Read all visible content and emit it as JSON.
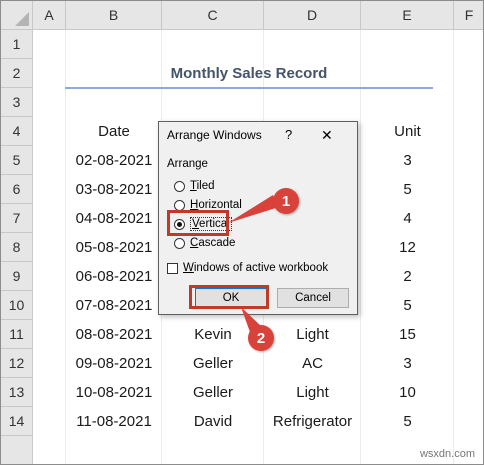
{
  "columns": [
    "A",
    "B",
    "C",
    "D",
    "E",
    "F"
  ],
  "rows": [
    "1",
    "2",
    "3",
    "4",
    "5",
    "6",
    "7",
    "8",
    "9",
    "10",
    "11",
    "12",
    "13",
    "14"
  ],
  "sheet": {
    "title": "Monthly Sales Record",
    "headers": {
      "date": "Date",
      "unit": "Unit"
    },
    "dates": [
      "02-08-2021",
      "03-08-2021",
      "04-08-2021",
      "05-08-2021",
      "06-08-2021",
      "07-08-2021",
      "08-08-2021",
      "09-08-2021",
      "10-08-2021",
      "11-08-2021"
    ],
    "units": [
      "3",
      "5",
      "4",
      "12",
      "2",
      "5",
      "15",
      "3",
      "10",
      "5"
    ],
    "names": [
      "Kevin",
      "Geller",
      "Geller",
      "David"
    ],
    "products": [
      "Light",
      "AC",
      "Light",
      "Refrigerator"
    ]
  },
  "dialog": {
    "title": "Arrange Windows",
    "help": "?",
    "close": "✕",
    "group_label": "Arrange",
    "options": [
      {
        "label": "Tiled",
        "checked": false
      },
      {
        "label": "Horizontal",
        "checked": false
      },
      {
        "label": "Vertical",
        "checked": true
      },
      {
        "label": "Cascade",
        "checked": false
      }
    ],
    "checkbox_label": "Windows of active workbook",
    "checkbox_checked": false,
    "ok_label": "OK",
    "cancel_label": "Cancel"
  },
  "annotations": {
    "badge1": "1",
    "badge2": "2",
    "color": "#d9423b"
  },
  "watermark": "wsxdn.com"
}
